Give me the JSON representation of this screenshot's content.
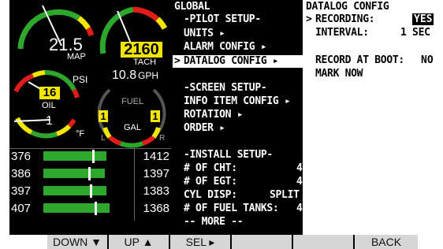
{
  "gauges": {
    "map": {
      "value": "21.5",
      "label": "MAP"
    },
    "tach": {
      "value": "2160",
      "label": "TACH"
    },
    "gph": {
      "value": "10.8",
      "unit": "GPH"
    },
    "oil_psi": {
      "value": "16",
      "unit": "PSI"
    },
    "oil_label": "OIL",
    "oil_temp": {
      "value": "1",
      "unit": "°F"
    },
    "fuel": {
      "label": "FUEL",
      "unit": "GAL",
      "left": "1",
      "right": "1",
      "left_tag": "L",
      "right_tag": "R"
    }
  },
  "bars": [
    {
      "left": "376",
      "right": "1412",
      "fill": 0.8,
      "mark": 0.62
    },
    {
      "left": "386",
      "right": "1397",
      "fill": 0.78,
      "mark": 0.57
    },
    {
      "left": "397",
      "right": "1383",
      "fill": 0.8,
      "mark": 0.59
    },
    {
      "left": "407",
      "right": "1368",
      "fill": 0.84,
      "mark": 0.65
    }
  ],
  "menu": {
    "title": "GLOBAL",
    "pilot_setup": "-PILOT SETUP-",
    "units": "UNITS ▸",
    "alarm_config": "ALARM CONFIG ▸",
    "datalog_config": "DATALOG CONFIG ▸",
    "selector": ">",
    "screen_setup": "-SCREEN SETUP-",
    "info_item_config": "INFO ITEM CONFIG ▸",
    "rotation": "ROTATION ▸",
    "order": "ORDER ▸",
    "install_setup": "-INSTALL SETUP-",
    "num_cht_label": "# OF CHT:",
    "num_cht": "4",
    "num_egt_label": "# OF EGT:",
    "num_egt": "4",
    "cyl_disp_label": "CYL DISP:",
    "cyl_disp": "SPLIT",
    "fuel_tanks_label": "# OF FUEL TANKS:",
    "fuel_tanks": "4",
    "more": "-- MORE --"
  },
  "config": {
    "title": "DATALOG CONFIG",
    "selector": ">",
    "recording_label": "RECORDING:",
    "recording_value": "YES",
    "interval_label": "INTERVAL:",
    "interval_value": "1 SEC",
    "record_at_boot_label": "RECORD AT BOOT:",
    "record_at_boot_value": "NO",
    "mark_now": "MARK NOW"
  },
  "softkeys": {
    "down": "DOWN ▼",
    "up": "UP ▲",
    "sel": "SEL ▸",
    "blank1": "",
    "blank2": "",
    "back": "BACK"
  },
  "colors": {
    "green": "#2da82d",
    "yellow": "#f2e600",
    "red": "#e21b1b",
    "highlight": "#ffffff"
  }
}
